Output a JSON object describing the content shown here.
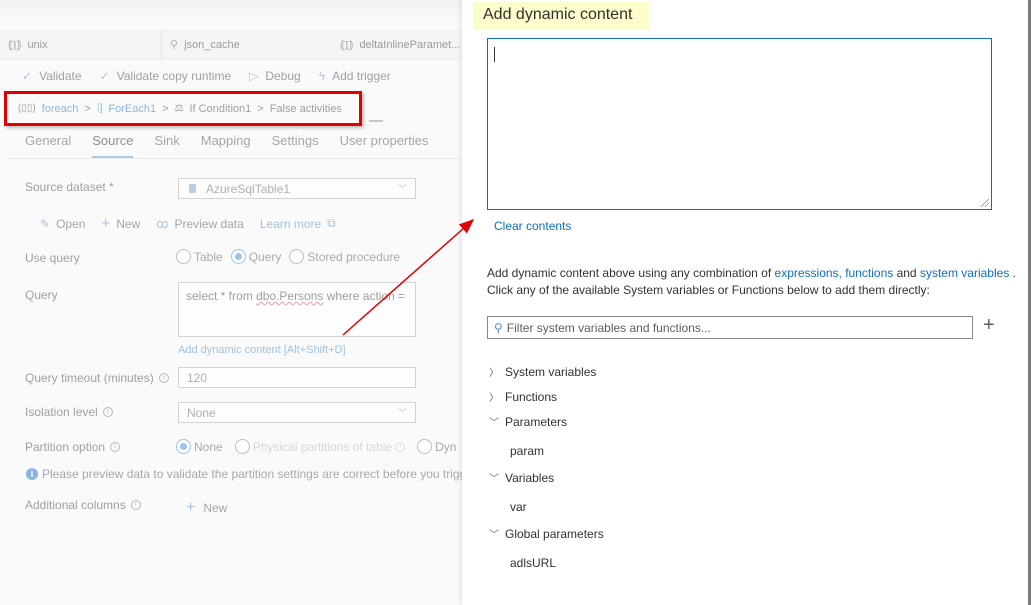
{
  "pipeline_tabs": [
    {
      "icon": "pipeline-icon",
      "label": "unix"
    },
    {
      "icon": "dataflow-icon",
      "label": "json_cache"
    },
    {
      "icon": "pipeline-icon",
      "label": "deltaInlineParamet..."
    }
  ],
  "toolbar": {
    "validate": "Validate",
    "validate_copy_runtime": "Validate copy runtime",
    "debug": "Debug",
    "add_trigger": "Add trigger"
  },
  "breadcrumb": {
    "items": [
      {
        "label": "foreach",
        "link": true
      },
      {
        "label": "ForEach1",
        "link": true
      },
      {
        "label": "If Condition1",
        "link": false
      },
      {
        "label": "False activities",
        "link": false
      }
    ],
    "separator": ">"
  },
  "property_tabs": [
    "General",
    "Source",
    "Sink",
    "Mapping",
    "Settings",
    "User properties"
  ],
  "active_property_tab": "Source",
  "source": {
    "dataset_label": "Source dataset *",
    "dataset_value": "AzureSqlTable1",
    "actions": {
      "open": "Open",
      "new": "New",
      "preview": "Preview data",
      "learn_more": "Learn more"
    },
    "use_query_label": "Use query",
    "use_query_options": [
      {
        "label": "Table",
        "selected": false
      },
      {
        "label": "Query",
        "selected": true
      },
      {
        "label": "Stored procedure",
        "selected": false
      }
    ],
    "query_label": "Query",
    "query_value_prefix": "select * from ",
    "query_value_squiggle": "dbo.Persons",
    "query_value_suffix": " where action =",
    "add_dynamic_content": "Add dynamic content [Alt+Shift+D]",
    "timeout_label": "Query timeout (minutes)",
    "timeout_value": "120",
    "isolation_label": "Isolation level",
    "isolation_value": "None",
    "partition_label": "Partition option",
    "partition_options": [
      {
        "label": "None",
        "selected": true,
        "disabled": false
      },
      {
        "label": "Physical partitions of table",
        "selected": false,
        "disabled": true
      },
      {
        "label": "Dyn",
        "selected": false,
        "disabled": false
      }
    ],
    "notice": "Please preview data to validate the partition settings are correct before you trigg",
    "additional_columns_label": "Additional columns",
    "additional_columns_new": "New"
  },
  "dynamic_panel": {
    "title": "Add dynamic content",
    "expression_value": "",
    "clear_contents": "Clear contents",
    "help_line1_prefix": "Add dynamic content above using any combination of ",
    "help_link1": "expressions, functions",
    "help_mid": " and ",
    "help_link2": "system variables",
    "help_line1_suffix": " .",
    "help_line2": "Click any of the available System variables or Functions below to add them directly:",
    "filter_placeholder": "Filter system variables and functions...",
    "tree": [
      {
        "label": "System variables",
        "expanded": false,
        "children": []
      },
      {
        "label": "Functions",
        "expanded": false,
        "children": []
      },
      {
        "label": "Parameters",
        "expanded": true,
        "children": [
          "param"
        ]
      },
      {
        "label": "Variables",
        "expanded": true,
        "children": [
          "var"
        ]
      },
      {
        "label": "Global parameters",
        "expanded": true,
        "children": [
          "adlsURL"
        ]
      }
    ]
  },
  "colors": {
    "accent": "#0f6cbd",
    "link": "#106ebe",
    "highlight": "#fdfccb",
    "annotation_red": "#e00000"
  }
}
